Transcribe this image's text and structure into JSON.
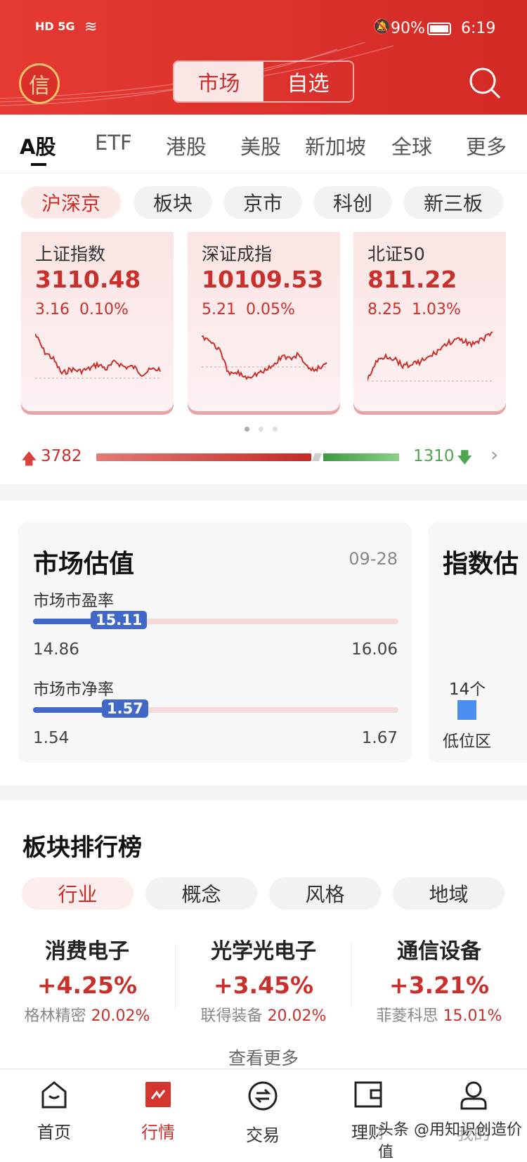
{
  "status_bar": {
    "network": "HD 5G",
    "battery": "90%",
    "time": "6:19"
  },
  "header": {
    "logo": "信",
    "segments": [
      "市场",
      "自选"
    ],
    "active_segment": 0
  },
  "market_tabs": [
    "A股",
    "ETF",
    "港股",
    "美股",
    "新加坡",
    "全球",
    "更多"
  ],
  "sub_chips": [
    "沪深京",
    "板块",
    "京市",
    "科创",
    "新三板"
  ],
  "index_cards": [
    {
      "name": "上证指数",
      "price": "3110.48",
      "change": "3.16",
      "pct": "0.10%"
    },
    {
      "name": "深证成指",
      "price": "10109.53",
      "change": "5.21",
      "pct": "0.05%"
    },
    {
      "name": "北证50",
      "price": "811.22",
      "change": "8.25",
      "pct": "1.03%"
    }
  ],
  "breadth": {
    "up": "3782",
    "down": "1310",
    "up_color": "#d9413a",
    "down_color": "#4fa552"
  },
  "valuation": {
    "title": "市场估值",
    "date": "09-28",
    "pe": {
      "label": "市场市盈率",
      "value": "15.11",
      "min": "14.86",
      "max": "16.06"
    },
    "pb": {
      "label": "市场市净率",
      "value": "1.57",
      "min": "1.54",
      "max": "1.67"
    }
  },
  "index_valuation": {
    "title": "指数估",
    "count": "14个",
    "zone": "低位区"
  },
  "sector_rank": {
    "title": "板块排行榜",
    "chips": [
      "行业",
      "概念",
      "风格",
      "地域"
    ],
    "items": [
      {
        "name": "消费电子",
        "pct": "+4.25%",
        "stock": "格林精密",
        "stock_pct": "20.02%"
      },
      {
        "name": "光学光电子",
        "pct": "+3.45%",
        "stock": "联得装备",
        "stock_pct": "20.02%"
      },
      {
        "name": "通信设备",
        "pct": "+3.21%",
        "stock": "菲菱科思",
        "stock_pct": "15.01%"
      }
    ],
    "more": "查看更多"
  },
  "tabbar": [
    "首页",
    "行情",
    "交易",
    "理财",
    "我的"
  ],
  "watermark": "头条 @用知识创造价值",
  "colors": {
    "brand": "#d9302c",
    "accent_blue": "#4168c9"
  }
}
